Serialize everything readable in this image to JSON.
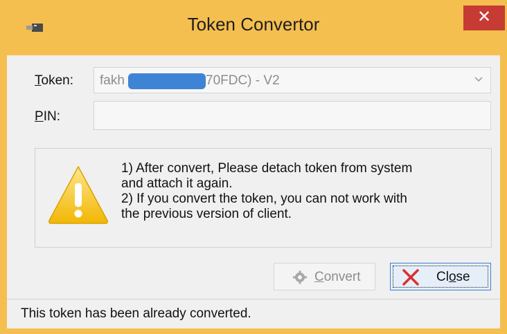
{
  "window": {
    "title": "Token Convertor",
    "close_glyph": "✕"
  },
  "form": {
    "token_label_ul": "T",
    "token_label_rest": "oken:",
    "token_value_prefix": "fakh",
    "token_value_suffix": "70FDC) - V2",
    "pin_label_ul": "P",
    "pin_label_rest": "IN:",
    "pin_value": ""
  },
  "message": {
    "line1": "1) After convert, Please detach token from system",
    "line2": "and attach it again.",
    "line3": "2) If you convert the token, you can not work with",
    "line4": "the previous version of client."
  },
  "buttons": {
    "convert_ul": "C",
    "convert_rest": "onvert",
    "close_pre": "Cl",
    "close_ul": "o",
    "close_rest": "se"
  },
  "status": {
    "text": "This token has been already converted."
  },
  "colors": {
    "titlebar": "#f5bf4f",
    "close_button": "#c73b35",
    "redaction": "#3f84d4",
    "warning": "#f6c21c"
  },
  "icons": {
    "app": "usb-token-icon",
    "warning": "warning-triangle-icon",
    "convert": "gear-icon",
    "close": "red-x-icon",
    "dropdown": "chevron-down-icon"
  }
}
